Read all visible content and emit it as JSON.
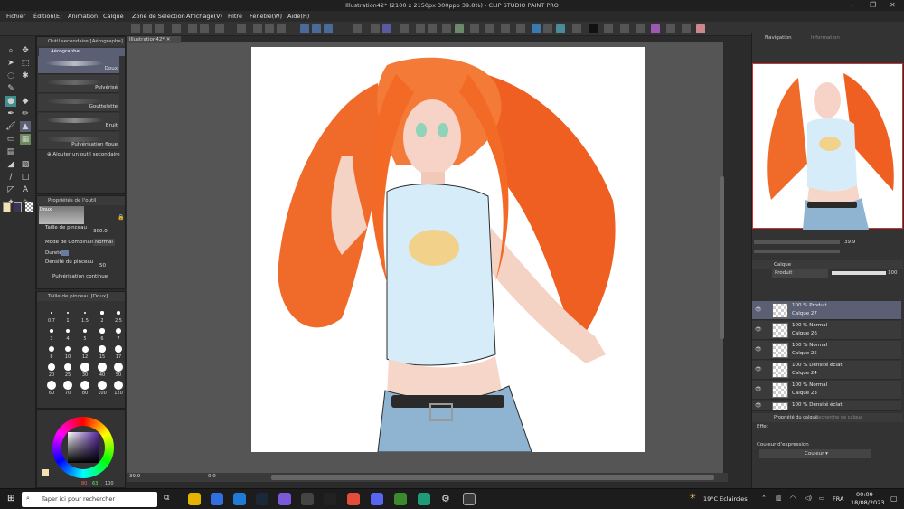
{
  "window": {
    "title": "Illustration42* (2100 x 2150px 300ppp 39.8%) - CLIP STUDIO PAINT PRO"
  },
  "menu": [
    "Fichier",
    "Édition(E)",
    "Animation",
    "Calque",
    "Zone de Sélection",
    "Affichage(V)",
    "Filtre",
    "Fenêtre(W)",
    "Aide(H)"
  ],
  "doc_tab": "Illustration42*",
  "subtool_panel": {
    "title": "Outil secondaire [Aérographe]",
    "group": "Aérographe",
    "items": [
      "Doux",
      "Pulvérisé",
      "Gouttelette",
      "Bruit",
      "Pulvérisation floue"
    ],
    "add_label": "Ajouter un outil secondaire"
  },
  "tool_props": {
    "title": "Propriétés de l'outil",
    "preset": "Doux",
    "brush_size_label": "Taille de pinceau",
    "brush_size_value": "300.0",
    "blend_label": "Mode de Combinaison",
    "blend_value": "Normal",
    "hardness_label": "Dureté",
    "density_label": "Densité du pinceau",
    "density_value": "50",
    "continuous_label": "Pulvérisation continue"
  },
  "brush_size_panel": {
    "title": "Taille de pinceau [Doux]",
    "sizes": [
      "0.7",
      "1",
      "1.5",
      "2",
      "2.5",
      "3",
      "4",
      "5",
      "6",
      "7",
      "8",
      "10",
      "12",
      "15",
      "17",
      "20",
      "25",
      "30",
      "40",
      "50",
      "60",
      "70",
      "80",
      "100",
      "120"
    ]
  },
  "color": {
    "r": "80",
    "g": "63",
    "b": "100",
    "main": "#3d3352",
    "accent": "#5a5f74"
  },
  "navigator": {
    "tab1": "Navigation",
    "tab2": "Information"
  },
  "nav_zoom": "39.9",
  "layer_panel": {
    "title": "Calque",
    "blend": "Produit",
    "opacity": "100",
    "layers": [
      {
        "mode": "100 % Produit",
        "name": "Calque 27",
        "selected": true
      },
      {
        "mode": "100 % Normal",
        "name": "Calque 26",
        "selected": false
      },
      {
        "mode": "100 % Normal",
        "name": "Calque 25",
        "selected": false
      },
      {
        "mode": "100 % Densité éclat",
        "name": "Calque 24",
        "selected": false
      },
      {
        "mode": "100 % Normal",
        "name": "Calque 23",
        "selected": false
      },
      {
        "mode": "100 % Densité éclat",
        "name": "",
        "selected": false
      }
    ]
  },
  "props_panel": {
    "tab1": "Propriété du calque",
    "tab2": "Recherche de calque",
    "effect_label": "Effet",
    "expr_label": "Couleur d'expression",
    "expr_value": "Couleur"
  },
  "status": {
    "zoom": "39.9",
    "angle": "0.0"
  },
  "taskbar": {
    "search": "Taper ici pour rechercher",
    "weather": "19°C  Eclaircies",
    "lang": "FRA",
    "time": "00:09",
    "date": "18/08/2023"
  }
}
